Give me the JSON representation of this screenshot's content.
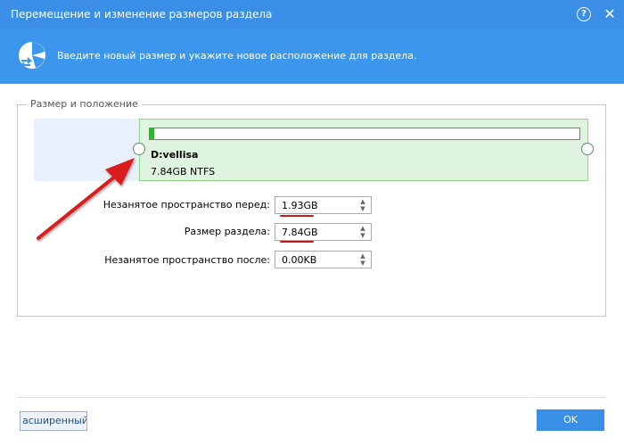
{
  "window": {
    "title": "Перемещение и изменение размеров раздела",
    "help_icon": "?",
    "close_icon": "✕"
  },
  "banner": {
    "text": "Введите новый размер и укажите новое расположение для раздела.",
    "icon": "partition-resize-icon"
  },
  "group": {
    "legend": "Размер и положение"
  },
  "partition": {
    "name": "D:vellisa",
    "info": "7.84GB NTFS",
    "used_fraction": 0.01
  },
  "fields": [
    {
      "label": "Незанятое пространство перед:",
      "value": "1.93GB"
    },
    {
      "label": "Размер раздела:",
      "value": "7.84GB"
    },
    {
      "label": "Незанятое пространство после:",
      "value": "0.00KB"
    }
  ],
  "buttons": {
    "advanced": "асширенный>>",
    "ok": "OK"
  },
  "colors": {
    "accent": "#3a8ee6",
    "partition_fill": "#dff4de",
    "annotation": "#c41a1a"
  }
}
